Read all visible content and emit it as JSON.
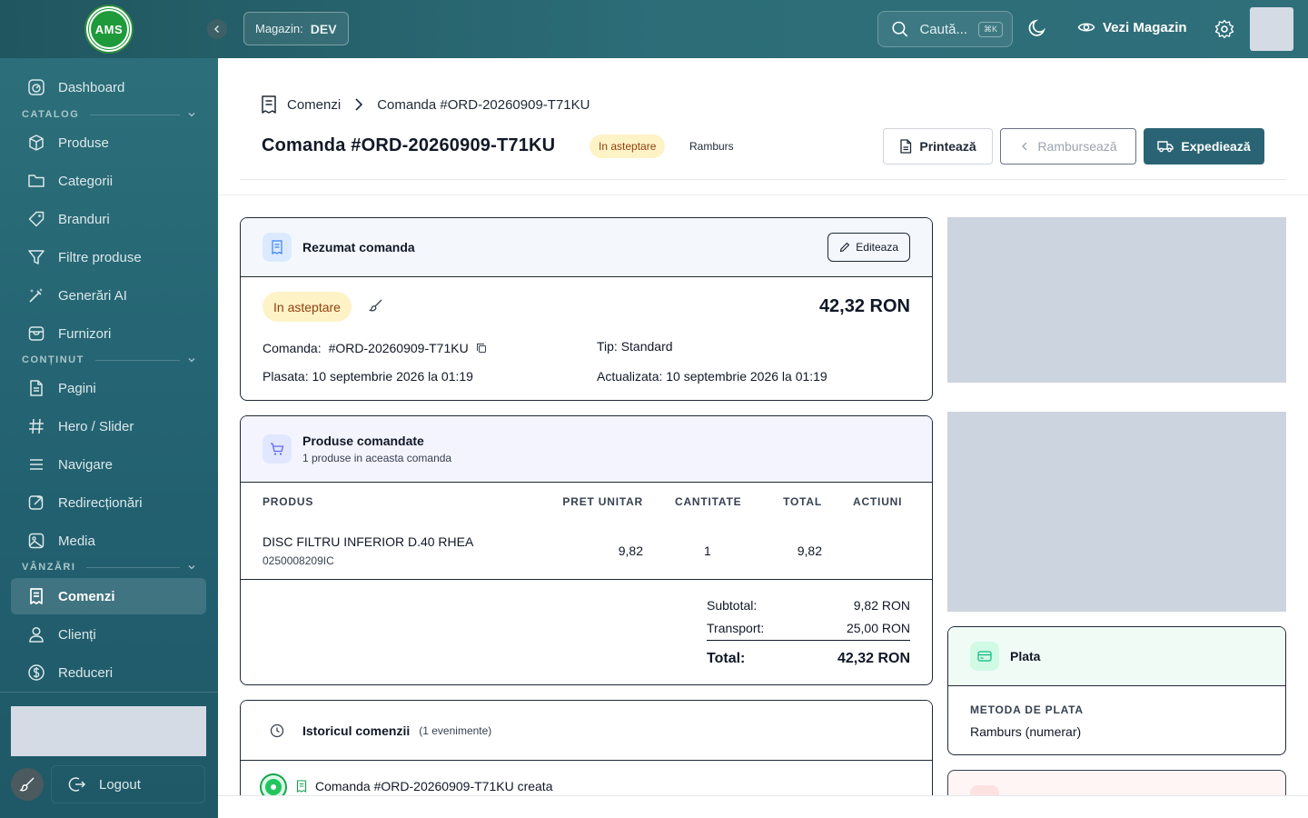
{
  "topbar": {
    "logo_text": "AMS",
    "store_label": "Magazin:",
    "store_value": "DEV",
    "search_placeholder": "Caută...",
    "search_shortcut": "⌘K",
    "view_store": "Vezi Magazin"
  },
  "sidebar": {
    "dashboard": "Dashboard",
    "section_catalog": "CATALOG",
    "produse": "Produse",
    "categorii": "Categorii",
    "branduri": "Branduri",
    "filtre": "Filtre produse",
    "generari": "Generări AI",
    "furnizori": "Furnizori",
    "section_continut": "CONȚINUT",
    "pagini": "Pagini",
    "hero": "Hero / Slider",
    "navigare": "Navigare",
    "redirectionari": "Redirecționări",
    "media": "Media",
    "section_vanzari": "VÂNZĂRI",
    "comenzi": "Comenzi",
    "clienti": "Clienți",
    "reduceri": "Reduceri",
    "logout": "Logout"
  },
  "header": {
    "breadcrumb_root": "Comenzi",
    "breadcrumb_current": "Comanda #ORD-20260909-T71KU",
    "title": "Comanda #ORD-20260909-T71KU",
    "status": "In asteptare",
    "payment_tag": "Ramburs",
    "print": "Printează",
    "refund": "Rambursează",
    "ship": "Expediează"
  },
  "summary": {
    "title": "Rezumat comanda",
    "edit": "Editeaza",
    "status": "In asteptare",
    "total": "42,32 RON",
    "order_label": "Comanda:",
    "order_no": "#ORD-20260909-T71KU",
    "type": "Tip: Standard",
    "placed": "Plasata: 10 septembrie 2026 la 01:19",
    "updated": "Actualizata: 10 septembrie 2026 la 01:19"
  },
  "products": {
    "title": "Produse comandate",
    "subtitle": "1 produse in aceasta comanda",
    "columns": [
      "PRODUS",
      "PRET UNITAR",
      "CANTITATE",
      "TOTAL",
      "ACTIUNI"
    ],
    "rows": [
      {
        "name": "DISC FILTRU INFERIOR D.40 RHEA",
        "sku": "0250008209IC",
        "unit_price": "9,82",
        "qty": "1",
        "total": "9,82"
      }
    ],
    "subtotal_label": "Subtotal:",
    "subtotal": "9,82 RON",
    "shipping_label": "Transport:",
    "shipping": "25,00 RON",
    "total_label": "Total:",
    "total": "42,32 RON"
  },
  "history": {
    "title": "Istoricul comenzii",
    "count": "(1 evenimente)",
    "event": "Comanda #ORD-20260909-T71KU creata"
  },
  "payment": {
    "title": "Plata",
    "method_label": "METODA DE PLATA",
    "method": "Ramburs (numerar)"
  }
}
